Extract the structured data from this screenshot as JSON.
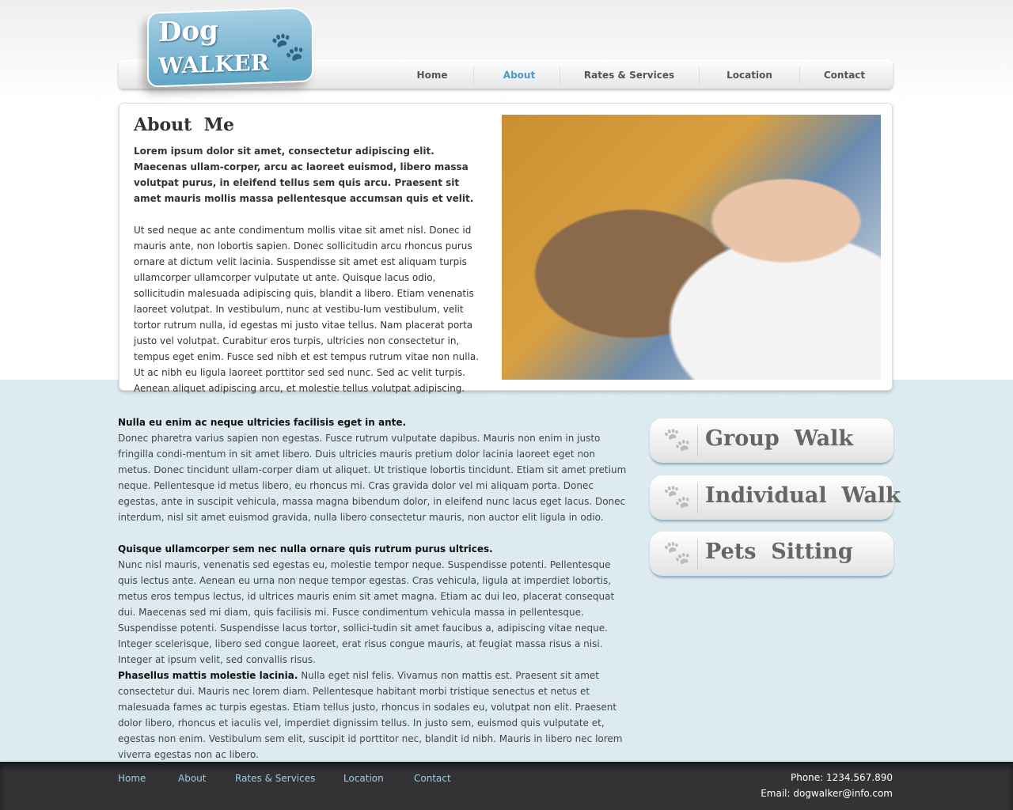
{
  "logo": {
    "line1": "Dog",
    "line2": "WALKER",
    "icon": "paw-icon"
  },
  "nav": [
    {
      "label": "Home"
    },
    {
      "label": "About",
      "active": true
    },
    {
      "label": "Rates & Services"
    },
    {
      "label": "Location"
    },
    {
      "label": "Contact"
    }
  ],
  "about": {
    "title": "About  Me",
    "lead": "Lorem ipsum dolor sit amet, consectetur adipiscing elit. Maecenas ullam-corper, arcu ac laoreet euismod, libero massa volutpat purus, in eleifend tellus sem quis arcu. Praesent sit amet mauris mollis massa pellentesque accumsan quis et velit.",
    "body": "Ut sed neque ac ante condimentum mollis vitae sit amet nisl. Donec id mauris ante, non lobortis sapien. Donec sollicitudin arcu rhoncus purus ornare at dictum velit lacinia. Suspendisse sit amet est aliquam turpis ullamcorper ullamcorper vulputate ut ante. Quisque lacus odio, sollicitudin malesuada adipiscing quis, blandit a libero. Etiam venenatis laoreet volutpat. In vestibulum, nunc at vestibu-lum vestibulum, velit tortor rutrum nulla, id egestas mi justo vitae tellus. Nam placerat porta justo vel volutpat. Curabitur eros turpis, ultricies non consectetur in, tempus eget enim. Fusce sed nibh et est tempus rutrum vitae non nulla. Ut ac nibh eu ligula laoreet porttitor sed sed nunc. Sed ac velit turpis. Aenean aliquet adipiscing arcu, et molestie tellus volutpat adipiscing."
  },
  "sections": [
    {
      "heading": "Nulla eu enim ac neque ultricies facilisis eget in ante.",
      "text": "Donec pharetra varius sapien non egestas. Fusce rutrum vulputate dapibus. Mauris non enim in justo fringilla condi-mentum in sit amet libero. Duis ultricies mauris pretium dolor lacinia laoreet eget non metus. Donec tincidunt ullam-corper diam ut aliquet. Ut tristique lobortis tincidunt. Etiam sit amet pretium neque. Pellentesque id metus libero, eu rhoncus mi. Cras gravida dolor vel mi aliquam porta. Donec egestas, ante in suscipit vehicula, massa magna bibendum dolor, in eleifend nunc lacus eget lacus. Donec interdum, nisl sit amet euismod gravida, nulla libero consectetur mauris, non auctor elit ligula in odio."
    },
    {
      "heading": "Quisque ullamcorper sem nec nulla ornare quis rutrum purus ultrices.",
      "text": "Nunc nisl mauris, venenatis sed egestas eu, molestie tempor neque. Suspendisse potenti. Pellentesque quis lectus ante. Aenean eu urna non neque tempor egestas. Cras vehicula, ligula at imperdiet lobortis, metus eros tempus lectus, id ultrices mauris enim sit amet magna. Etiam ac dui leo, placerat consequat dui. Maecenas sed mi diam, quis facilisis mi. Fusce condimentum vehicula massa in pellentesque. Suspendisse potenti. Suspendisse lacus tortor, sollici-tudin sit amet faucibus a, adipiscing vitae neque. Integer scelerisque, libero sed congue laoreet, erat risus congue mauris, at feugiat massa risus a nisi. Integer at ipsum velit, sed convallis risus."
    },
    {
      "heading": "Phasellus mattis molestie lacinia.",
      "text": " Nulla eget nisl felis. Vivamus non mattis est. Praesent sit amet consectetur dui. Mauris nec lorem diam. Pellentesque habitant morbi tristique senectus et netus et malesuada fames ac turpis egestas. Etiam tellus justo, rhoncus in sodales eu, volutpat non elit. Praesent dolor libero, rhoncus et iaculis vel, imperdiet dignissim tellus. In justo sem, euismod quis vulputate et, egestas non enim. Vestibulum sem elit, suscipit id porttitor nec, blandit id nibh. Mauris in libero nec lorem viverra egestas non ac libero."
    }
  ],
  "services": [
    {
      "label": "Group  Walk",
      "icon": "paw-icon"
    },
    {
      "label": "Individual  Walk",
      "icon": "paw-icon"
    },
    {
      "label": "Pets  Sitting",
      "icon": "paw-icon"
    }
  ],
  "footer": {
    "links": [
      "Home",
      "About",
      "Rates & Services",
      "Location",
      "Contact"
    ],
    "phone": "Phone: 1234.567.890",
    "email": "Email: dogwalker@info.com"
  }
}
